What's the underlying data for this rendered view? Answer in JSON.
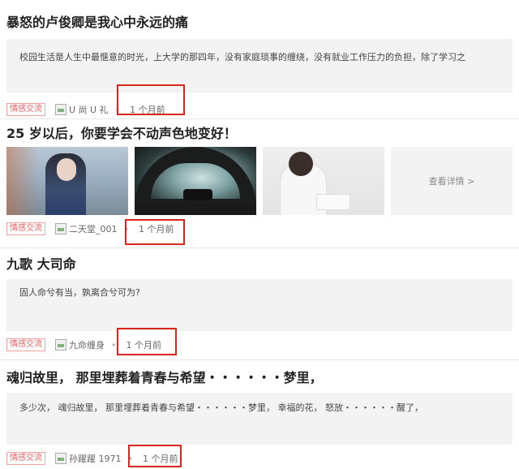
{
  "posts": [
    {
      "title": "暴怒的卢俊卿是我心中永远的痛",
      "excerpt": "校园生活是人生中最惬意的时光，上大学的那四年，没有家庭琐事的缠绕，没有就业工作压力的负担，除了学习之",
      "tag": "情感交流",
      "author": "U 尚 U 礼",
      "time": "1 个月前"
    },
    {
      "title": "25 岁以后，你要学会不动声色地变好！",
      "tag": "情感交流",
      "author": "二天堂_001",
      "time": "1 个月前",
      "more_label": "查看详情 >"
    },
    {
      "title": "九歌 大司命",
      "excerpt": "固人命兮有当，孰离合兮可为?",
      "tag": "情感交流",
      "author": "九命缠身",
      "time": "1 个月前"
    },
    {
      "title": "魂归故里， 那里埋葬着青春与希望・・・・・・梦里，",
      "excerpt": "多少次， 魂归故里， 那里埋葬着青春与希望・・・・・・梦里， 幸福的花， 怒放・・・・・・醒了，",
      "tag": "情感交流",
      "author": "孙躍躍 1971",
      "time": "1 个月前"
    }
  ],
  "colors": {
    "tag": "#e06363",
    "highlight": "#d9261c",
    "excerpt_bg": "#f3f3f4"
  },
  "icons": [
    "avatar-placeholder-icon"
  ]
}
